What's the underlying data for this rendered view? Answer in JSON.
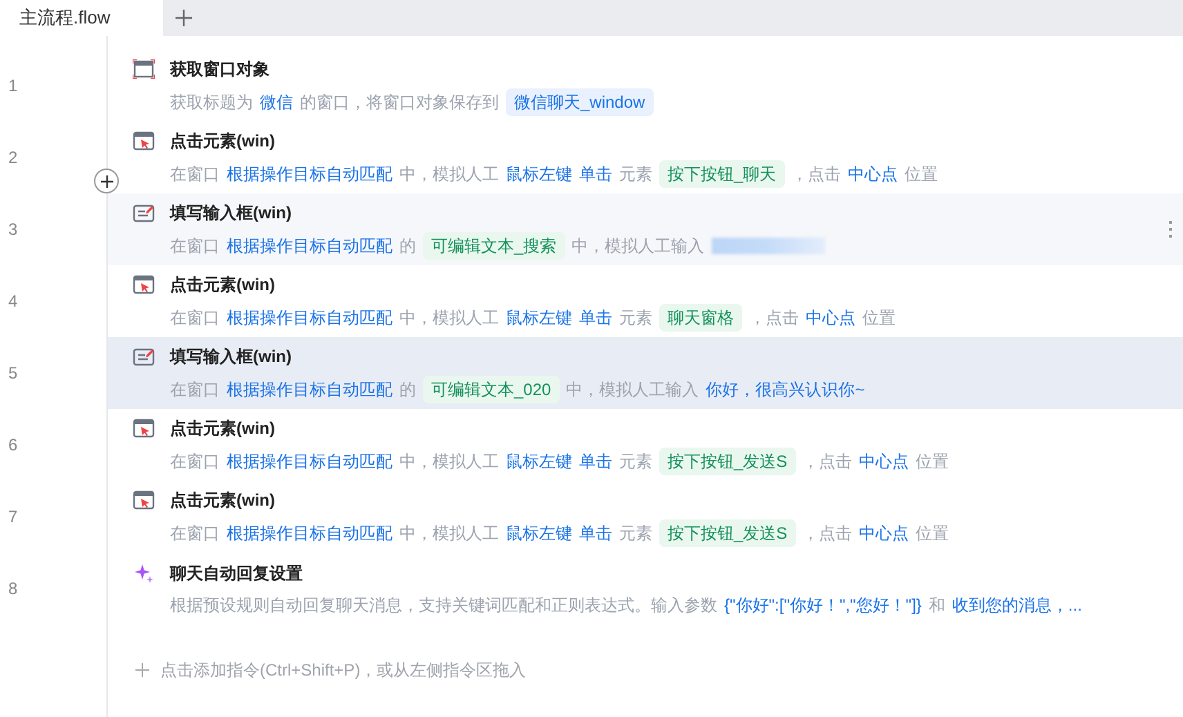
{
  "tabs": [
    {
      "label": "主流程.flow",
      "selected": true
    }
  ],
  "steps": [
    {
      "number": "1",
      "kind": "window",
      "title": "获取窗口对象",
      "hovered": false,
      "selected": false,
      "desc": [
        {
          "kind": "plain",
          "text": "获取标题为"
        },
        {
          "kind": "link",
          "text": "微信"
        },
        {
          "kind": "plain",
          "text": "的窗口，将窗口对象保存到"
        },
        {
          "kind": "var",
          "text": "微信聊天_window"
        }
      ]
    },
    {
      "number": "2",
      "kind": "click",
      "title": "点击元素(win)",
      "hovered": false,
      "selected": false,
      "desc": [
        {
          "kind": "plain",
          "text": "在窗口"
        },
        {
          "kind": "link",
          "text": "根据操作目标自动匹配"
        },
        {
          "kind": "plain",
          "text": "中，模拟人工"
        },
        {
          "kind": "link",
          "text": "鼠标左键"
        },
        {
          "kind": "link",
          "text": "单击"
        },
        {
          "kind": "plain",
          "text": "元素"
        },
        {
          "kind": "element",
          "text": "按下按钮_聊天"
        },
        {
          "kind": "plain",
          "text": "，点击"
        },
        {
          "kind": "link",
          "text": "中心点"
        },
        {
          "kind": "plain",
          "text": "位置"
        }
      ]
    },
    {
      "number": "3",
      "kind": "input",
      "title": "填写输入框(win)",
      "hovered": true,
      "selected": false,
      "desc": [
        {
          "kind": "plain",
          "text": "在窗口"
        },
        {
          "kind": "link",
          "text": "根据操作目标自动匹配"
        },
        {
          "kind": "plain",
          "text": "的"
        },
        {
          "kind": "element",
          "text": "可编辑文本_搜索"
        },
        {
          "kind": "plain",
          "text": "中，模拟人工输入"
        },
        {
          "kind": "redacted"
        }
      ]
    },
    {
      "number": "4",
      "kind": "click",
      "title": "点击元素(win)",
      "hovered": false,
      "selected": false,
      "desc": [
        {
          "kind": "plain",
          "text": "在窗口"
        },
        {
          "kind": "link",
          "text": "根据操作目标自动匹配"
        },
        {
          "kind": "plain",
          "text": "中，模拟人工"
        },
        {
          "kind": "link",
          "text": "鼠标左键"
        },
        {
          "kind": "link",
          "text": "单击"
        },
        {
          "kind": "plain",
          "text": "元素"
        },
        {
          "kind": "element",
          "text": "聊天窗格"
        },
        {
          "kind": "plain",
          "text": "，点击"
        },
        {
          "kind": "link",
          "text": "中心点"
        },
        {
          "kind": "plain",
          "text": "位置"
        }
      ]
    },
    {
      "number": "5",
      "kind": "input",
      "title": "填写输入框(win)",
      "hovered": false,
      "selected": true,
      "desc": [
        {
          "kind": "plain",
          "text": "在窗口"
        },
        {
          "kind": "link",
          "text": "根据操作目标自动匹配"
        },
        {
          "kind": "plain",
          "text": "的"
        },
        {
          "kind": "element",
          "text": "可编辑文本_020"
        },
        {
          "kind": "plain",
          "text": "中，模拟人工输入"
        },
        {
          "kind": "link",
          "text": "你好，很高兴认识你~"
        }
      ]
    },
    {
      "number": "6",
      "kind": "click",
      "title": "点击元素(win)",
      "hovered": false,
      "selected": false,
      "desc": [
        {
          "kind": "plain",
          "text": "在窗口"
        },
        {
          "kind": "link",
          "text": "根据操作目标自动匹配"
        },
        {
          "kind": "plain",
          "text": "中，模拟人工"
        },
        {
          "kind": "link",
          "text": "鼠标左键"
        },
        {
          "kind": "link",
          "text": "单击"
        },
        {
          "kind": "plain",
          "text": "元素"
        },
        {
          "kind": "element",
          "text": "按下按钮_发送S"
        },
        {
          "kind": "plain",
          "text": "，点击"
        },
        {
          "kind": "link",
          "text": "中心点"
        },
        {
          "kind": "plain",
          "text": "位置"
        }
      ]
    },
    {
      "number": "7",
      "kind": "click",
      "title": "点击元素(win)",
      "hovered": false,
      "selected": false,
      "desc": [
        {
          "kind": "plain",
          "text": "在窗口"
        },
        {
          "kind": "link",
          "text": "根据操作目标自动匹配"
        },
        {
          "kind": "plain",
          "text": "中，模拟人工"
        },
        {
          "kind": "link",
          "text": "鼠标左键"
        },
        {
          "kind": "link",
          "text": "单击"
        },
        {
          "kind": "plain",
          "text": "元素"
        },
        {
          "kind": "element",
          "text": "按下按钮_发送S"
        },
        {
          "kind": "plain",
          "text": "，点击"
        },
        {
          "kind": "link",
          "text": "中心点"
        },
        {
          "kind": "plain",
          "text": "位置"
        }
      ]
    },
    {
      "number": "8",
      "kind": "ai",
      "title": "聊天自动回复设置",
      "hovered": false,
      "selected": false,
      "desc": [
        {
          "kind": "plain",
          "text": "根据预设规则自动回复聊天消息，支持关键词匹配和正则表达式。输入参数"
        },
        {
          "kind": "link",
          "text": "{\"你好\":[\"你好！\",\"您好！\"]}"
        },
        {
          "kind": "plain",
          "text": "和"
        },
        {
          "kind": "link",
          "text": "收到您的消息，..."
        }
      ]
    }
  ],
  "add_hint": "点击添加指令(Ctrl+Shift+P)，或从左侧指令区拖入"
}
